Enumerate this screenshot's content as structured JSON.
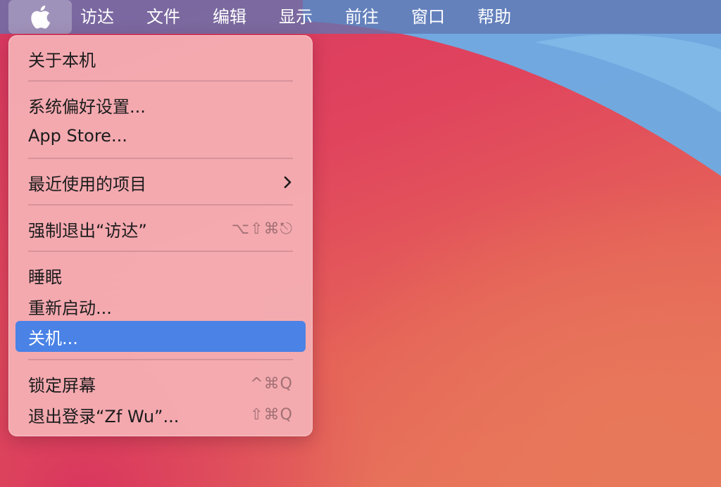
{
  "menubar": {
    "items": [
      {
        "label": "访达"
      },
      {
        "label": "文件"
      },
      {
        "label": "编辑"
      },
      {
        "label": "显示"
      },
      {
        "label": "前往"
      },
      {
        "label": "窗口"
      },
      {
        "label": "帮助"
      }
    ]
  },
  "apple_menu": {
    "items": [
      {
        "label": "关于本机"
      },
      {
        "label": "系统偏好设置..."
      },
      {
        "label": "App Store..."
      },
      {
        "label": "最近使用的项目",
        "submenu_icon": "chevron-right-icon"
      },
      {
        "label": "强制退出“访达”",
        "shortcut": "⌥⇧⌘⎋"
      },
      {
        "label": "睡眠"
      },
      {
        "label": "重新启动..."
      },
      {
        "label": "关机...",
        "selected": true
      },
      {
        "label": "锁定屏幕",
        "shortcut": "^⌘Q"
      },
      {
        "label": "退出登录“Zf Wu”...",
        "shortcut": "⇧⌘Q"
      }
    ]
  },
  "colors": {
    "menubar": "#6076b2",
    "menu_bg": "#f5b2b6",
    "highlight": "#4a82e6",
    "wallpaper_red": "#e0445d",
    "wallpaper_blue": "#6aaee6"
  },
  "icons": {
    "apple": "apple-logo-icon"
  }
}
